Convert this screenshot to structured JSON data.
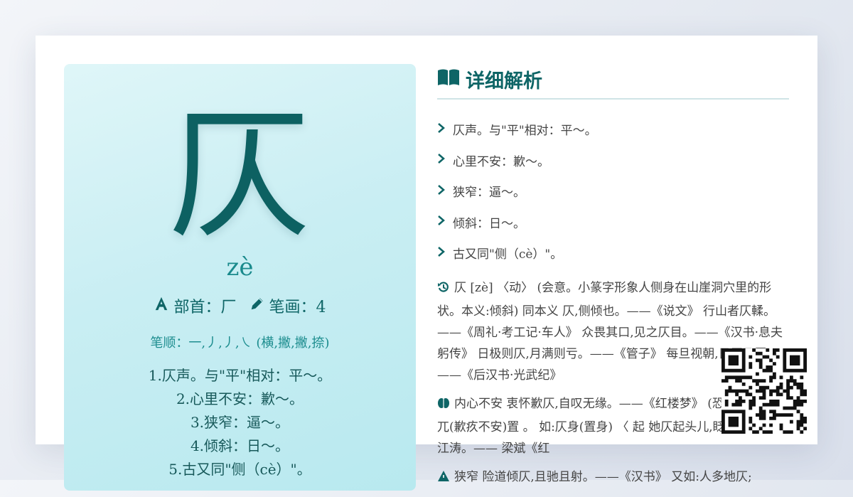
{
  "character": {
    "glyph": "仄",
    "pinyin": "zè",
    "radical_label": "部首：厂",
    "strokes_label": "笔画：4",
    "stroke_order": "笔顺：一,丿,丿,㇏ (横,撇,撇,捺)",
    "brief": [
      "1.仄声。与\"平\"相对：平～。",
      "2.心里不安：歉～。",
      "3.狭窄：逼～。",
      "4.倾斜：日～。",
      "5.古又同\"侧（cè）\"。"
    ]
  },
  "detail": {
    "title": "详细解析",
    "definitions": [
      "仄声。与\"平\"相对：平～。",
      "心里不安：歉～。",
      "狭窄：逼～。",
      "倾斜：日～。",
      "古又同\"侧（cè）\"。"
    ],
    "paragraphs": [
      "仄 [zè] 〈动〉 (会意。小篆字形象人侧身在山崖洞穴里的形状。本义:倾斜) 同本义 仄,侧倾也。——《说文》 行山者仄輮。——《周礼·考工记·车人》 众畏其口,见之仄目。——《汉书·息夫躬传》 日极则仄,月满则亏。——《管子》 每旦视朝,日仄乃罢。——《后汉书·光武纪》",
      "内心不安 衷怀歉仄,自叹无缘。——《红楼梦》 (恐惧不安);仄兀(歉疚不安)置 。 如:仄身(置身) 〈 起 她仄起头儿,眨巴着眼睛瞅江涛。—— 梁斌《红",
      "狭窄 险道倾仄,且驰且射。——《汉书》 又如:人多地仄;"
    ]
  },
  "colors": {
    "accent": "#0e6566",
    "panel_start": "#dff6f8",
    "panel_end": "#b8e9ef"
  }
}
